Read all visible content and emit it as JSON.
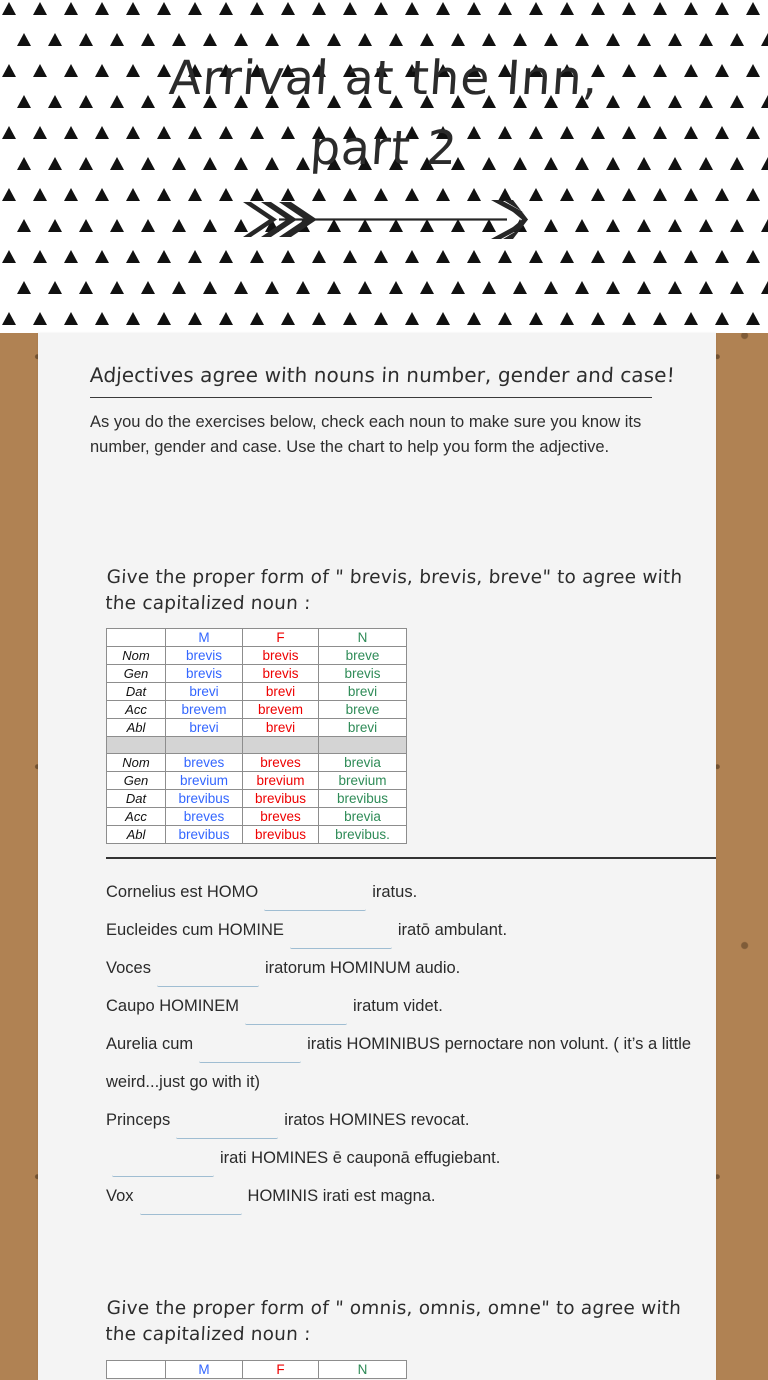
{
  "header": {
    "title_line1": "Arrival at the Inn,",
    "title_line2": "part 2",
    "arrow_icon": "long-arrow-right-icon",
    "pattern_icon": "triangle-pattern"
  },
  "callout": {
    "heading": "Adjectives agree with nouns in number, gender and case!",
    "body": "As you do the exercises below, check each noun to make sure you know its number, gender and case. Use the chart to help you form the adjective."
  },
  "section1": {
    "prompt": "Give the proper form of \" brevis, brevis, breve\" to agree with the capitalized noun :",
    "table": {
      "headers": [
        "",
        "M",
        "F",
        "N"
      ],
      "singular": [
        {
          "case": "Nom",
          "m": "brevis",
          "f": "brevis",
          "n": "breve"
        },
        {
          "case": "Gen",
          "m": "brevis",
          "f": "brevis",
          "n": "brevis"
        },
        {
          "case": "Dat",
          "m": "brevi",
          "f": "brevi",
          "n": "brevi"
        },
        {
          "case": "Acc",
          "m": "brevem",
          "f": "brevem",
          "n": "breve"
        },
        {
          "case": "Abl",
          "m": "brevi",
          "f": "brevi",
          "n": "brevi"
        }
      ],
      "plural": [
        {
          "case": "Nom",
          "m": "breves",
          "f": "breves",
          "n": "brevia"
        },
        {
          "case": "Gen",
          "m": "brevium",
          "f": "brevium",
          "n": "brevium"
        },
        {
          "case": "Dat",
          "m": "brevibus",
          "f": "brevibus",
          "n": "brevibus"
        },
        {
          "case": "Acc",
          "m": "breves",
          "f": "breves",
          "n": "brevia"
        },
        {
          "case": "Abl",
          "m": "brevibus",
          "f": "brevibus",
          "n": "brevibus."
        }
      ]
    }
  },
  "exercises": [
    {
      "before": "Cornelius est HOMO",
      "value": "",
      "after": "iratus."
    },
    {
      "before": "Eucleides cum HOMINE",
      "value": "",
      "after": "iratō ambulant."
    },
    {
      "before": "Voces",
      "value": "",
      "after": "iratorum HOMINUM audio."
    },
    {
      "before": "Caupo HOMINEM",
      "value": "",
      "after": "iratum videt."
    },
    {
      "before": "Aurelia cum",
      "value": "",
      "after": "iratis HOMINIBUS pernoctare non volunt. ( it’s a little weird...just go with it)"
    },
    {
      "before": "Princeps",
      "value": "",
      "after": "iratos HOMINES revocat."
    },
    {
      "before": "",
      "value": "",
      "after": "irati HOMINES ē cauponā effugiebant."
    },
    {
      "before": "Vox",
      "value": "",
      "after": "HOMINIS irati est magna."
    }
  ],
  "section2": {
    "prompt": "Give the proper form of \" omnis, omnis, omne\" to agree with the capitalized noun :",
    "table": {
      "headers": [
        "",
        "M",
        "F",
        "N"
      ]
    }
  },
  "colors": {
    "masculine": "#3366ff",
    "feminine": "#ee0000",
    "neuter": "#2e8b57",
    "blank_underline": "#9fbdd2",
    "card_bg": "#f4f4f4",
    "page_bg": "#b08253"
  }
}
